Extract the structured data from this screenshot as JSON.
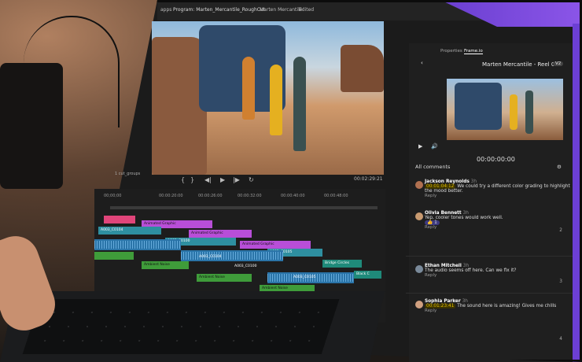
{
  "window": {
    "menu_label": "apps",
    "tab_program": "Program: Marten_Mercantile_RoughCut",
    "title": "Marten Mercantile",
    "status": "Edited"
  },
  "timeline": {
    "sequence_name": "1 cut_groups",
    "timecode_end": "00:02:29:21",
    "ruler": [
      "00;00;00",
      "00:00:20:00",
      "00:00:26:00",
      "00:00:32:00",
      "00:00:40:00",
      "00:00:48:00"
    ],
    "clips": {
      "graphic_1": "Animated Graphic",
      "graphic_2": "Animated Graphic",
      "graphic_3": "Animated Graphic",
      "video_1": "A003_C0104",
      "video_2": "A003_C0100",
      "video_3": "A003_C0105",
      "title_1": "Bridge Circles",
      "title_2": "Black C",
      "audio_1": "A003_C0104",
      "audio_2": "A003_C0105",
      "audio_3": "A003_C0100",
      "ambient_1": "Ambient Noise",
      "ambient_2": "Ambient Noise",
      "ambient_3": "Ambient Noise",
      "ambient_4": "Ambient Noise"
    }
  },
  "right_panel": {
    "tab_properties": "Properties",
    "tab_frameio": "Frame.io",
    "project_title": "Marten Mercantile - Reel 01",
    "version_badge": "V2",
    "timecode": "00:00:00:00",
    "comments_filter": "All comments",
    "comments": [
      {
        "name": "Jackson Reynolds",
        "time": "3h",
        "timecode": "00:01:04:12",
        "text": "We could try a different color grading to highlight the mood better.",
        "reply": "Reply"
      },
      {
        "name": "Olivia Bennett",
        "time": "3h",
        "text": "Yep, cooler tones would work well.",
        "reaction": "1",
        "count": "2",
        "reply": "Reply"
      },
      {
        "name": "Ethan Mitchell",
        "time": "3h",
        "text": "The audio seems off here. Can we fix it?",
        "reply": "Reply"
      },
      {
        "name": "Sophia Parker",
        "time": "3h",
        "timecode": "00:01:23:41",
        "text": "The sound here is amazing! Gives me chills",
        "count": "4",
        "reply": "Reply"
      }
    ],
    "comment_count_3": "3"
  },
  "colors": {
    "accent_purple": "#7b4be0",
    "timecode_yellow": "#e8c300",
    "clip_pink": "#e0457a",
    "clip_purple": "#b84ed8",
    "clip_teal": "#1f8a7a",
    "clip_green": "#3f9c3a",
    "audio_blue": "#2a74a8"
  }
}
